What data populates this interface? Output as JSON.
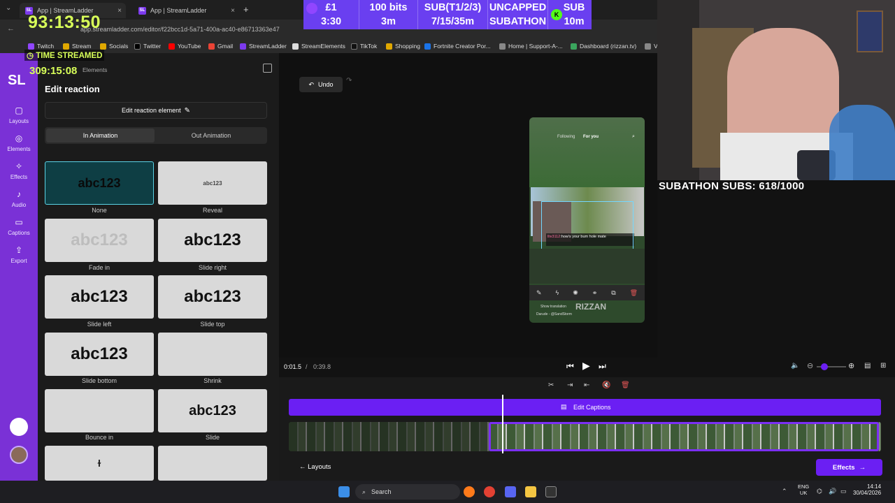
{
  "browser": {
    "tabs": [
      {
        "title": "App | StreamLadder"
      },
      {
        "title": "App | StreamLadder"
      }
    ],
    "new_tab": "+",
    "url": "app.streamladder.com/editor/f22bcc1d-5a71-400a-ac40-e86713363e47",
    "bookmarks": [
      "Twitch",
      "Stream",
      "Socials",
      "Twitter",
      "YouTube",
      "Gmail",
      "StreamLadder",
      "StreamElements",
      "TikTok",
      "Shopping",
      "Fortnite Creator Por...",
      "Home | Support-A-...",
      "Dashboard (rizzan.tv)",
      "VE"
    ]
  },
  "overlay": {
    "timer": "93:13:50",
    "time_streamed_label": "TIME STREAMED",
    "time_streamed_value": "309:15:08",
    "goals": [
      {
        "top": "£1",
        "bottom": "3:30"
      },
      {
        "top": "100 bits",
        "bottom": "3m"
      },
      {
        "top": "SUB(T1/2/3)",
        "bottom": "7/15/35m"
      },
      {
        "top": "UNCAPPED",
        "bottom": "SUBATHON"
      },
      {
        "top": "SUB",
        "bottom": "10m"
      }
    ],
    "subathon": "SUBATHON SUBS: 618/1000"
  },
  "rail": {
    "logo": "SL",
    "items": [
      {
        "label": "Layouts"
      },
      {
        "label": "Elements"
      },
      {
        "label": "Effects"
      },
      {
        "label": "Audio"
      },
      {
        "label": "Captions"
      },
      {
        "label": "Export"
      }
    ]
  },
  "panel": {
    "breadcrumb": "Elements",
    "title": "Edit reaction",
    "edit_element": "Edit reaction element",
    "tabs": [
      "In Animation",
      "Out Animation"
    ],
    "sample_text": "abc123",
    "animations": [
      "None",
      "Reveal",
      "Fade in",
      "Slide right",
      "Slide left",
      "Slide top",
      "Slide bottom",
      "Shrink",
      "Bounce in",
      "Slide"
    ]
  },
  "editor": {
    "undo": "Undo",
    "comment_user": "lliv3112",
    "comment_text": ":how's your bum hole mate",
    "phone_tabs": [
      "Following",
      "For you"
    ],
    "watermark": "RIZZAN",
    "show_translation": "Show translation",
    "music": "Darude - @SandStorm",
    "time_current": "0:01.5",
    "time_separator": "/",
    "time_total": "0:39.8",
    "captions_label": "Edit Captions",
    "layouts_button": "Layouts",
    "effects_button": "Effects"
  },
  "taskbar": {
    "search": "Search",
    "lang_top": "ENG",
    "lang_bottom": "UK",
    "time": "14:14",
    "date": "30/04/2026"
  }
}
